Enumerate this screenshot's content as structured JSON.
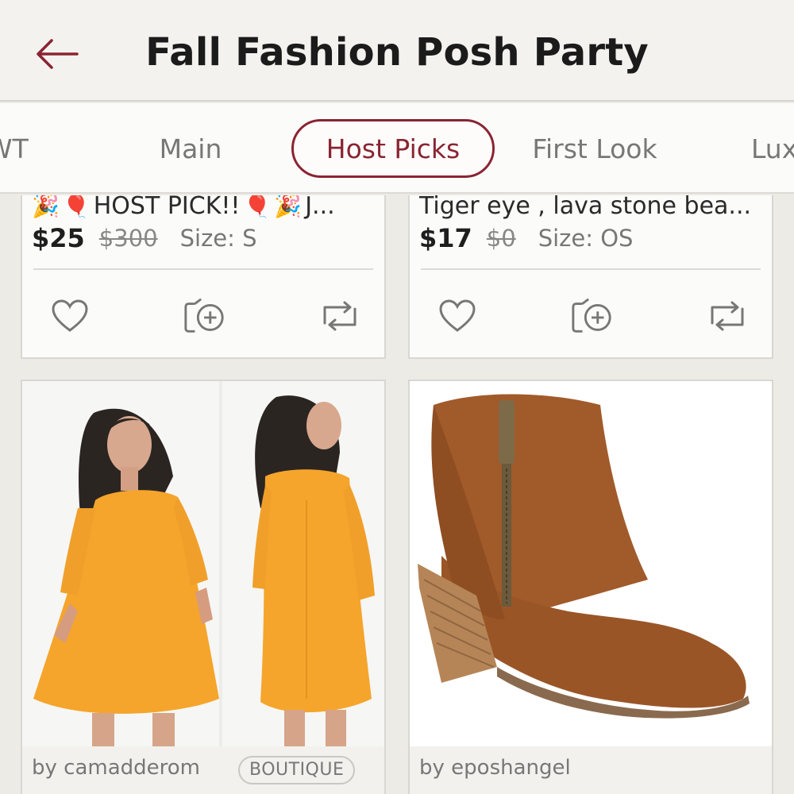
{
  "header": {
    "title": "Fall Fashion Posh Party",
    "back_icon": "arrow-left-icon"
  },
  "colors": {
    "accent": "#8a2432",
    "background": "#ecebe6"
  },
  "tabs": [
    {
      "label": "NWT",
      "active": false
    },
    {
      "label": "Main",
      "active": false
    },
    {
      "label": "Host Picks",
      "active": true
    },
    {
      "label": "First Look",
      "active": false
    },
    {
      "label": "Luxury",
      "active": false
    }
  ],
  "listings_top": [
    {
      "title": "HOST PICK!!",
      "title_suffix": "J...",
      "price": "$25",
      "original_price": "$300",
      "size": "Size: S"
    },
    {
      "title": "Tiger eye , lava stone bea...",
      "price": "$17",
      "original_price": "$0",
      "size": "Size: OS"
    }
  ],
  "listings_bottom": [
    {
      "seller": "by camadderom",
      "badge": "BOUTIQUE",
      "image": "orange cold-shoulder dress"
    },
    {
      "seller": "by eposhangel",
      "image": "tan suede ankle boot"
    }
  ],
  "actions": {
    "like_icon": "heart-icon",
    "share_icon": "share-add-icon",
    "repost_icon": "repost-icon"
  }
}
